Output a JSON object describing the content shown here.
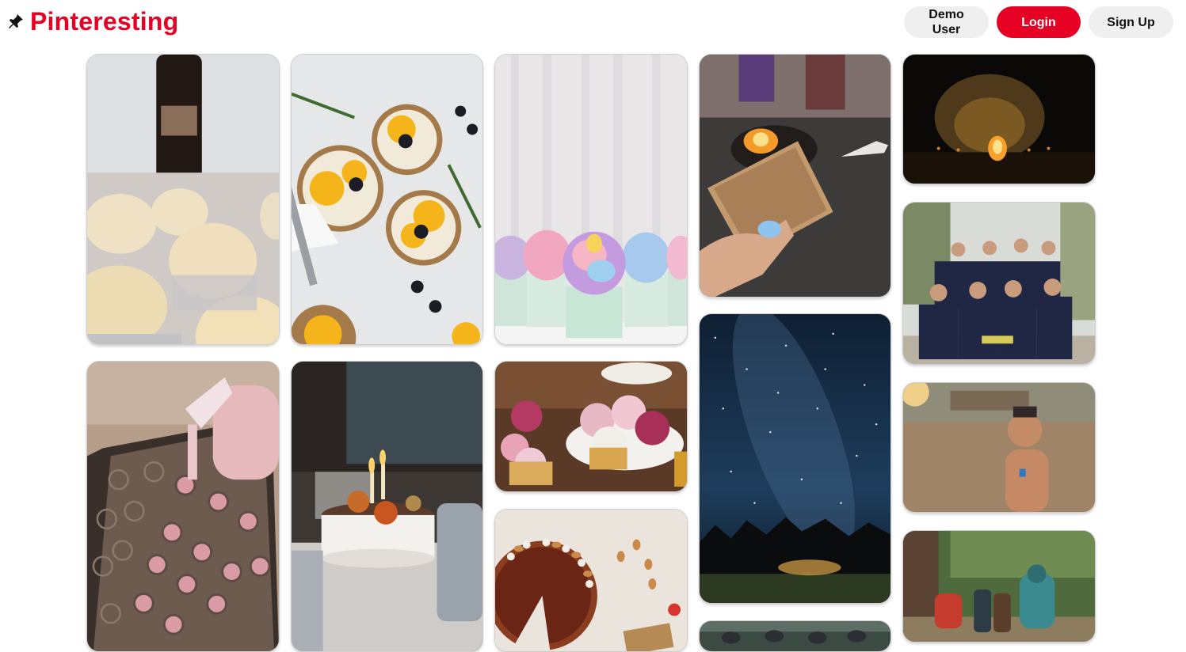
{
  "header": {
    "logo_text": "Pinteresting",
    "logo_icon": "pushpin-icon",
    "demo_label": "Demo User",
    "login_label": "Login",
    "signup_label": "Sign Up"
  },
  "colors": {
    "brand": "#e60023",
    "button_gray": "#efefef"
  },
  "pins": [
    {
      "col": 0,
      "subject": "vanilla cupcakes with bottle"
    },
    {
      "col": 0,
      "subject": "piping pink macarons"
    },
    {
      "col": 1,
      "subject": "citrus blackberry tarts"
    },
    {
      "col": 1,
      "subject": "birthday cake with candles"
    },
    {
      "col": 2,
      "subject": "pastel rainbow cupcakes"
    },
    {
      "col": 2,
      "subject": "flower cupcakes"
    },
    {
      "col": 2,
      "subject": "pecan pie"
    },
    {
      "col": 3,
      "subject": "smores by campfire"
    },
    {
      "col": 3,
      "subject": "milky way night sky"
    },
    {
      "col": 3,
      "subject": "group at campsite"
    },
    {
      "col": 4,
      "subject": "bonfire at night"
    },
    {
      "col": 4,
      "subject": "softball team group photo"
    },
    {
      "col": 4,
      "subject": "smiling boy at sunset"
    },
    {
      "col": 4,
      "subject": "hikers with backpacks"
    }
  ]
}
